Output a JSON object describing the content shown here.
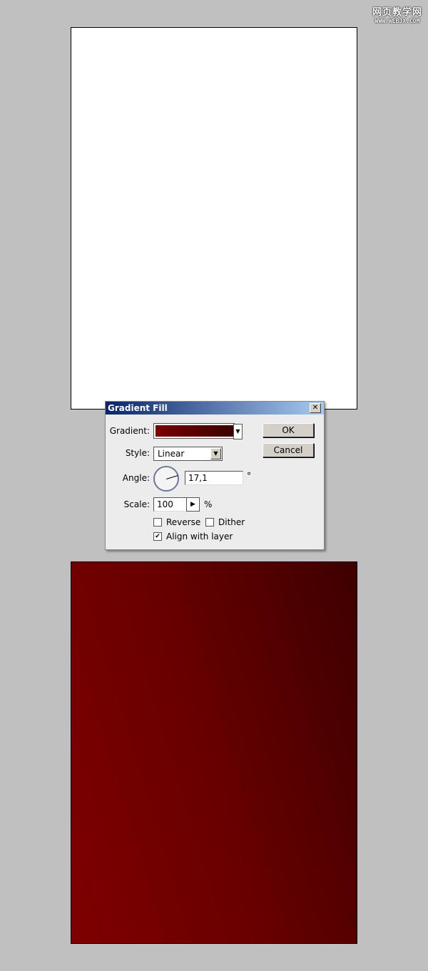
{
  "watermark": {
    "line1": "网页教学网",
    "line2": "WWW.WEBJX.COM"
  },
  "dialog": {
    "title": "Gradient Fill",
    "gradient_label": "Gradient:",
    "gradient_colors": [
      "#7a0000",
      "#3a0000"
    ],
    "style_label": "Style:",
    "style_value": "Linear",
    "angle_label": "Angle:",
    "angle_value": "17,1",
    "angle_unit": "°",
    "scale_label": "Scale:",
    "scale_value": "100",
    "scale_unit": "%",
    "reverse_label": "Reverse",
    "reverse_checked": false,
    "dither_label": "Dither",
    "dither_checked": false,
    "align_label": "Align with layer",
    "align_checked": true,
    "ok_label": "OK",
    "cancel_label": "Cancel"
  },
  "result_gradient_colors": [
    "#7e0000",
    "#3e0000"
  ]
}
